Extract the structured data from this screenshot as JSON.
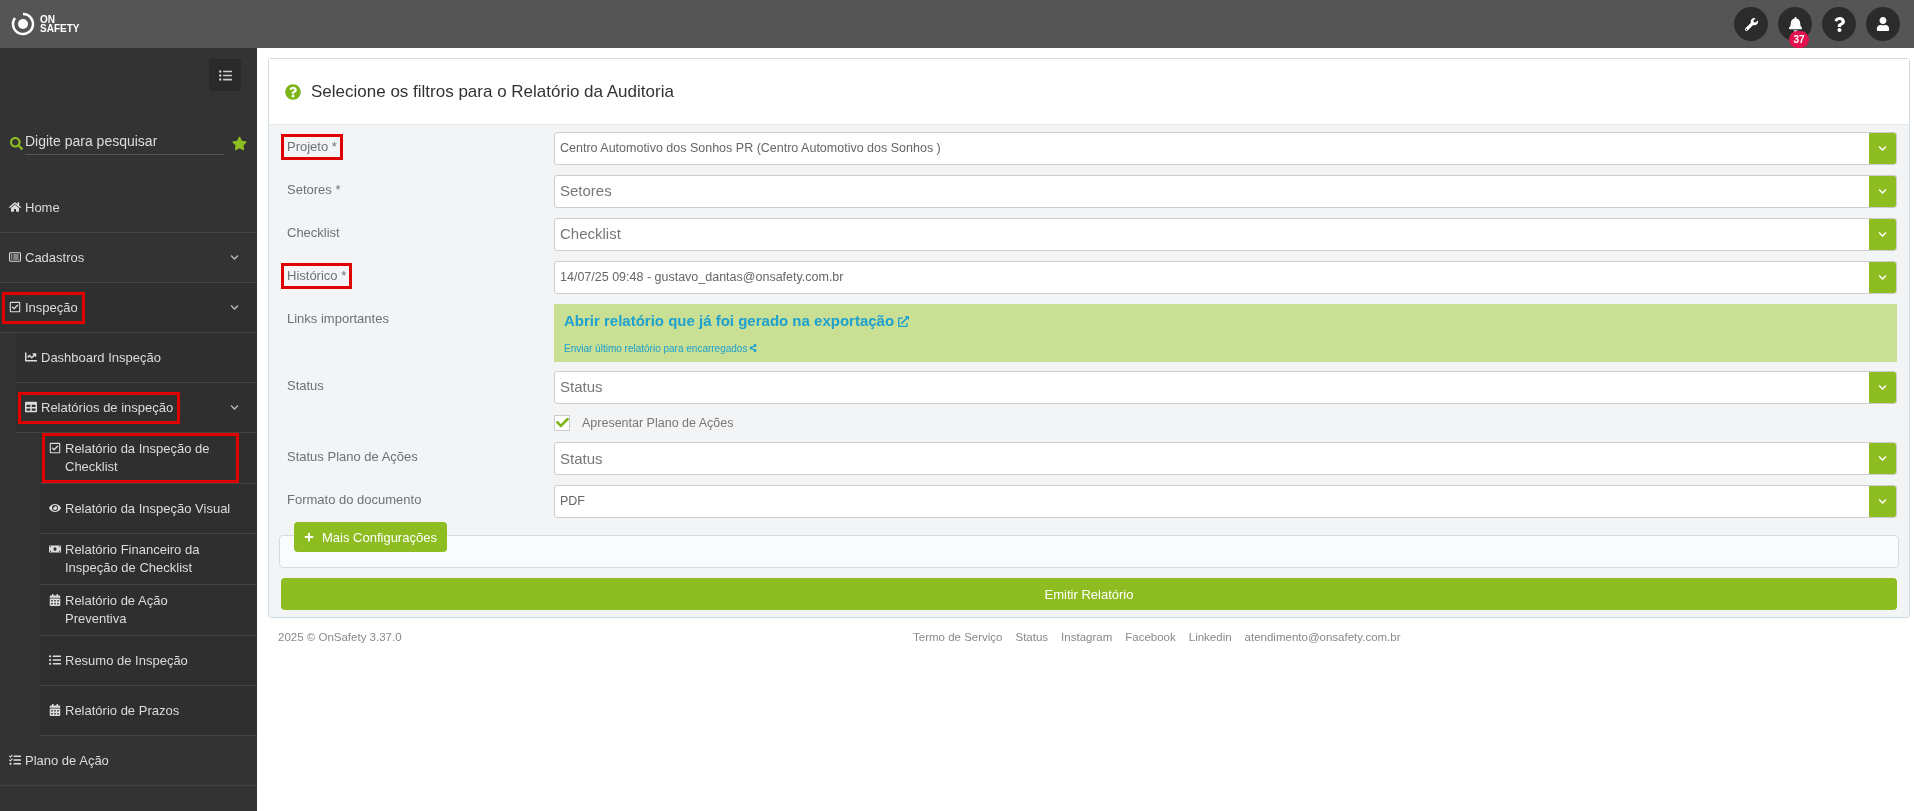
{
  "header": {
    "logo_text": [
      "ON",
      "SAFETY"
    ],
    "notifications": {
      "count": "37"
    }
  },
  "sidebar": {
    "search": {
      "placeholder": "Digite para pesquisar"
    },
    "items": [
      {
        "label": "Home",
        "collapsible": false,
        "highlighted": false
      },
      {
        "label": "Cadastros",
        "collapsible": true,
        "highlighted": false
      },
      {
        "label": "Inspeção",
        "collapsible": true,
        "highlighted": true,
        "children": [
          {
            "label": "Dashboard Inspeção",
            "collapsible": false,
            "highlighted": false
          },
          {
            "label": "Relatórios de inspeção",
            "collapsible": true,
            "highlighted": true,
            "children": [
              {
                "label": "Relatório da Inspeção de Checklist",
                "collapsible": false,
                "highlighted": true
              },
              {
                "label": "Relatório da Inspeção Visual",
                "collapsible": false,
                "highlighted": false
              },
              {
                "label": "Relatório Financeiro da Inspeção de Checklist",
                "collapsible": false,
                "highlighted": false
              },
              {
                "label": "Relatório de Ação Preventiva",
                "collapsible": false,
                "highlighted": false
              },
              {
                "label": "Resumo de Inspeção",
                "collapsible": false,
                "highlighted": false
              },
              {
                "label": "Relatório de Prazos",
                "collapsible": false,
                "highlighted": false
              }
            ]
          }
        ]
      },
      {
        "label": "Plano de Ação",
        "collapsible": false,
        "highlighted": false
      }
    ]
  },
  "form": {
    "title": "Selecione os filtros para o Relatório da Auditoria",
    "fields": [
      {
        "kind": "select",
        "label": "Projeto",
        "required_mark": "*",
        "highlighted": true,
        "value": "Centro Automotivo dos Sonhos PR (Centro Automotivo dos Sonhos )"
      },
      {
        "kind": "select",
        "label": "Setores",
        "required_mark": "*",
        "highlighted": false,
        "placeholder": "Setores"
      },
      {
        "kind": "select",
        "label": "Checklist",
        "highlighted": false,
        "placeholder": "Checklist"
      },
      {
        "kind": "select",
        "label": "Histórico",
        "required_mark": "*",
        "highlighted": true,
        "value": "14/07/25 09:48 - gustavo_dantas@onsafety.com.br"
      },
      {
        "kind": "links",
        "label": "Links importantes",
        "highlighted": false,
        "primary_link": "Abrir relatório que já foi gerado na exportação",
        "secondary_link": "Enviar último relatório para encarregados"
      },
      {
        "kind": "select",
        "label": "Status",
        "highlighted": false,
        "placeholder": "Status"
      },
      {
        "kind": "checkbox",
        "text": "Apresentar Plano de Ações",
        "checked": true
      },
      {
        "kind": "select",
        "label": "Status Plano de Ações",
        "highlighted": false,
        "placeholder": "Status"
      },
      {
        "kind": "select",
        "label": "Formato do documento",
        "highlighted": false,
        "value": "PDF"
      }
    ],
    "more_button": "Mais Configurações",
    "submit_button": "Emitir Relatório"
  },
  "footer": {
    "copyright": "2025 © OnSafety 3.37.0",
    "links": [
      "Termo de Serviço",
      "Status",
      "Instagram",
      "Facebook",
      "Linkedin",
      "atendimento@onsafety.com.br"
    ]
  }
}
